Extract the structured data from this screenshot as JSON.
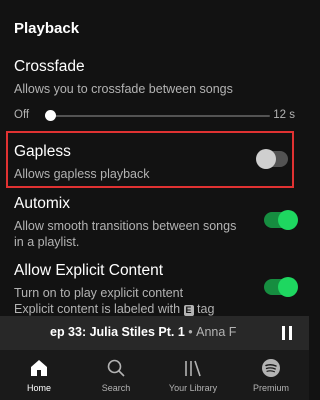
{
  "section_title": "Playback",
  "crossfade": {
    "title": "Crossfade",
    "description": "Allows you to crossfade between songs",
    "slider_min_label": "Off",
    "slider_max_label": "12 s",
    "slider_value_fraction": 0.0
  },
  "gapless": {
    "title": "Gapless",
    "description": "Allows gapless playback",
    "enabled": false
  },
  "automix": {
    "title": "Automix",
    "description": "Allow smooth transitions between songs in a playlist.",
    "enabled": true
  },
  "explicit": {
    "title": "Allow Explicit Content",
    "description": "Turn on to play explicit content",
    "description_2": "Explicit content is labeled with",
    "badge": "E",
    "description_suffix": "tag",
    "enabled": true
  },
  "now_playing": {
    "title": "ep 33: Julia Stiles Pt. 1",
    "separator": "•",
    "artist": "Anna F"
  },
  "nav": {
    "home": "Home",
    "search": "Search",
    "library": "Your Library",
    "premium": "Premium"
  },
  "colors": {
    "accent": "#1ed760",
    "background": "#121212",
    "highlight": "#e03232"
  }
}
